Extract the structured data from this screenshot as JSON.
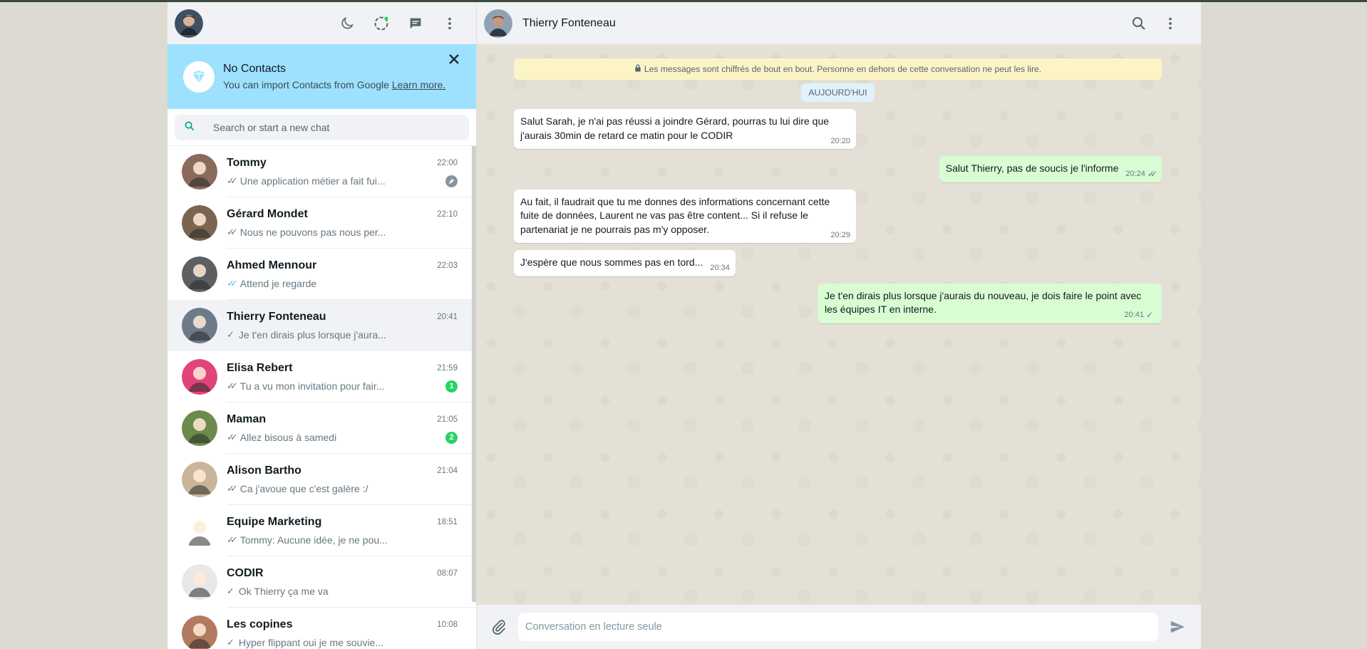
{
  "left_header": {
    "icons": [
      "theme-moon-icon",
      "status-icon",
      "new-chat-icon",
      "menu-icon"
    ]
  },
  "banner": {
    "title": "No Contacts",
    "subtitle": "You can import Contacts from Google",
    "link": "Learn more."
  },
  "search": {
    "placeholder": "Search or start a new chat"
  },
  "chats": [
    {
      "name": "Tommy",
      "time": "22:00",
      "preview": "Une application métier a fait fui...",
      "tick": "double",
      "badge": "",
      "pinned": true,
      "active": false,
      "avatar_color": "#8a6a5a"
    },
    {
      "name": "Gérard Mondet",
      "time": "22:10",
      "preview": "Nous ne pouvons pas nous per...",
      "tick": "double",
      "badge": "",
      "pinned": false,
      "active": false,
      "avatar_color": "#7a6550"
    },
    {
      "name": "Ahmed Mennour",
      "time": "22:03",
      "preview": "Attend je regarde",
      "tick": "double-blue",
      "badge": "",
      "pinned": false,
      "active": false,
      "avatar_color": "#5d5f63"
    },
    {
      "name": "Thierry Fonteneau",
      "time": "20:41",
      "preview": "Je t'en dirais plus lorsque j'aura...",
      "tick": "single",
      "badge": "",
      "pinned": false,
      "active": true,
      "avatar_color": "#6d7a88"
    },
    {
      "name": "Elisa Rebert",
      "time": "21:59",
      "preview": "Tu a vu mon invitation pour fair...",
      "tick": "double",
      "badge": "1",
      "pinned": false,
      "active": false,
      "avatar_color": "#e0457a"
    },
    {
      "name": "Maman",
      "time": "21:05",
      "preview": "Allez bisous à samedi",
      "tick": "double",
      "badge": "2",
      "pinned": false,
      "active": false,
      "avatar_color": "#6c8a4b"
    },
    {
      "name": "Alison Bartho",
      "time": "21:04",
      "preview": "Ca j'avoue que c'est galère :/",
      "tick": "double",
      "badge": "",
      "pinned": false,
      "active": false,
      "avatar_color": "#c9b59a"
    },
    {
      "name": "Equipe Marketing",
      "time": "18:51",
      "preview": "Tommy: Aucune idée, je ne pou...",
      "tick": "double",
      "badge": "",
      "pinned": false,
      "active": false,
      "avatar_color": "#ffffff"
    },
    {
      "name": "CODIR",
      "time": "08:07",
      "preview": "Ok Thierry ça me va",
      "tick": "single",
      "badge": "",
      "pinned": false,
      "active": false,
      "avatar_color": "#e8e8e8"
    },
    {
      "name": "Les copines",
      "time": "10:08",
      "preview": "Hyper flippant oui je me souvie...",
      "tick": "single",
      "badge": "",
      "pinned": false,
      "active": false,
      "avatar_color": "#b27a5e"
    }
  ],
  "conversation": {
    "contact_name": "Thierry Fonteneau",
    "encryption_note": "Les messages sont chiffrés de bout en bout. Personne en dehors de cette conversation ne peut les lire.",
    "date_label": "AUJOURD'HUI",
    "messages": [
      {
        "dir": "in",
        "text": "Salut Sarah, je n'ai pas réussi a joindre Gérard, pourras tu lui dire que j'aurais 30min de retard ce matin pour le CODIR",
        "time": "20:20",
        "tick": ""
      },
      {
        "dir": "out",
        "text": "Salut Thierry, pas de soucis je l'informe",
        "time": "20:24",
        "tick": "double"
      },
      {
        "dir": "in",
        "text": "Au fait, il faudrait que tu me donnes des informations concernant cette fuite de données, Laurent ne vas pas être content... Si il refuse le partenariat je ne pourrais pas m'y opposer.",
        "time": "20:29",
        "tick": ""
      },
      {
        "dir": "in",
        "text": "J'espère que nous sommes pas en tord...",
        "time": "20:34",
        "tick": ""
      },
      {
        "dir": "out",
        "text": "Je t'en dirais plus lorsque j'aurais du nouveau, je dois faire le point avec les équipes IT en interne.",
        "time": "20:41",
        "tick": "single"
      }
    ]
  },
  "composer": {
    "placeholder": "Conversation en lecture seule"
  },
  "colors": {
    "accent_green": "#25d366",
    "banner_blue": "#9de1fe",
    "outgoing_bubble": "#d9fdd3",
    "blue_tick": "#53bdeb"
  }
}
